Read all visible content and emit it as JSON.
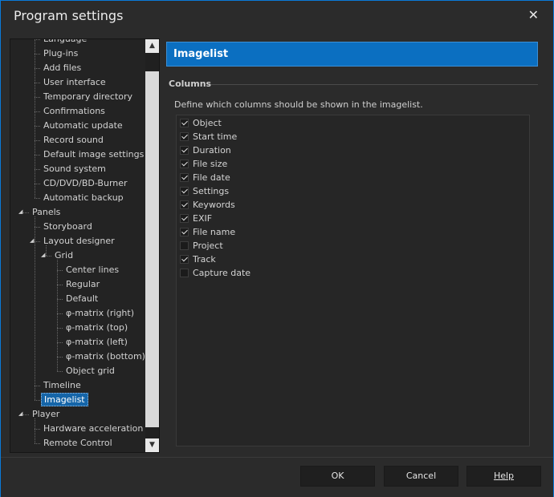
{
  "window": {
    "title": "Program settings",
    "close_glyph": "✕"
  },
  "tree": {
    "items": [
      {
        "label": "Language",
        "level": 1
      },
      {
        "label": "Plug-ins",
        "level": 1
      },
      {
        "label": "Add files",
        "level": 1
      },
      {
        "label": "User interface",
        "level": 1
      },
      {
        "label": "Temporary directory",
        "level": 1
      },
      {
        "label": "Confirmations",
        "level": 1
      },
      {
        "label": "Automatic update",
        "level": 1
      },
      {
        "label": "Record sound",
        "level": 1
      },
      {
        "label": "Default image settings",
        "level": 1
      },
      {
        "label": "Sound system",
        "level": 1
      },
      {
        "label": "CD/DVD/BD-Burner",
        "level": 1
      },
      {
        "label": "Automatic backup",
        "level": 1
      },
      {
        "label": "Panels",
        "level": 0,
        "expanded": true
      },
      {
        "label": "Storyboard",
        "level": 1
      },
      {
        "label": "Layout designer",
        "level": 1,
        "expanded": true
      },
      {
        "label": "Grid",
        "level": 2,
        "expanded": true
      },
      {
        "label": "Center lines",
        "level": 3
      },
      {
        "label": "Regular",
        "level": 3
      },
      {
        "label": "Default",
        "level": 3
      },
      {
        "label": "φ-matrix (right)",
        "level": 3
      },
      {
        "label": "φ-matrix (top)",
        "level": 3
      },
      {
        "label": "φ-matrix (left)",
        "level": 3
      },
      {
        "label": "φ-matrix (bottom)",
        "level": 3
      },
      {
        "label": "Object grid",
        "level": 3
      },
      {
        "label": "Timeline",
        "level": 1
      },
      {
        "label": "Imagelist",
        "level": 1,
        "selected": true
      },
      {
        "label": "Player",
        "level": 0,
        "expanded": true
      },
      {
        "label": "Hardware acceleration",
        "level": 1
      },
      {
        "label": "Remote Control",
        "level": 1
      }
    ]
  },
  "panel": {
    "header": "Imagelist",
    "group_title": "Columns",
    "description": "Define which columns should be shown in the imagelist.",
    "columns": [
      {
        "label": "Object",
        "checked": true
      },
      {
        "label": "Start time",
        "checked": true
      },
      {
        "label": "Duration",
        "checked": true
      },
      {
        "label": "File size",
        "checked": true
      },
      {
        "label": "File date",
        "checked": true
      },
      {
        "label": "Settings",
        "checked": true
      },
      {
        "label": "Keywords",
        "checked": true
      },
      {
        "label": "EXIF",
        "checked": true
      },
      {
        "label": "File name",
        "checked": true
      },
      {
        "label": "Project",
        "checked": false
      },
      {
        "label": "Track",
        "checked": true
      },
      {
        "label": "Capture date",
        "checked": false
      }
    ]
  },
  "footer": {
    "ok": "OK",
    "cancel": "Cancel",
    "help": "Help"
  },
  "colors": {
    "accent": "#0b6fc1",
    "background": "#2b2b2b",
    "selection": "#1565a8"
  },
  "icons": {
    "close": "close-icon",
    "scroll_up": "chevron-up-icon",
    "scroll_down": "chevron-down-icon",
    "expanded": "triangle-expanded-icon"
  }
}
